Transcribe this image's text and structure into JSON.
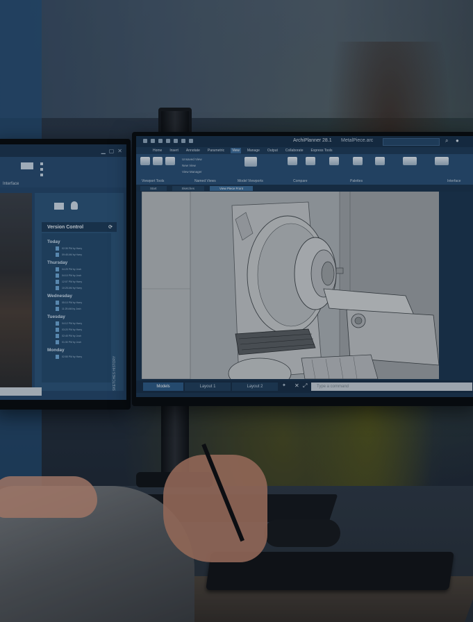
{
  "left_monitor": {
    "ribbon_label": "Interface",
    "version_control": {
      "title": "Version Control",
      "groups": [
        {
          "label": "Today",
          "entries": [
            "02:35 PM by Harry",
            "09:45 AM by Harry"
          ]
        },
        {
          "label": "Thursday",
          "entries": [
            "04:25 PM by Josh",
            "04:10 PM by Josh",
            "12:07 PM by Harry",
            "10:25 AM by Harry"
          ]
        },
        {
          "label": "Wednesday",
          "entries": [
            "05:10 PM by Harry",
            "11:25 AM by Josh"
          ]
        },
        {
          "label": "Tuesday",
          "entries": [
            "04:12 PM by Harry",
            "03:20 PM by Harry",
            "02:45 PM by Josh",
            "01:30 PM by Josh"
          ]
        },
        {
          "label": "Monday",
          "entries": [
            "02:55 PM by Harry"
          ]
        }
      ]
    },
    "side_tab": "SKETCHES HISTORY"
  },
  "right_monitor": {
    "app_title": "ArchiPlanner 28.1",
    "file_name": "MetalPiece.arc",
    "tabs": [
      "Home",
      "Insert",
      "Annotate",
      "Parametric",
      "View",
      "Manage",
      "Output",
      "Collaborate",
      "Express Tools"
    ],
    "active_tab": "View",
    "ribbon_groups": [
      "Viewport Tools",
      "Named Views",
      "Model Viewports",
      "Compare",
      "Palettes",
      "Interface"
    ],
    "ribbon_menu": [
      "Unsaved View",
      "New View",
      "View Manager"
    ],
    "doc_tabs": [
      "Start",
      "Sketches",
      "View Piece Front"
    ],
    "layout_tabs": [
      "Models",
      "Layout 1",
      "Layout 2"
    ],
    "command_placeholder": "Type a command"
  }
}
